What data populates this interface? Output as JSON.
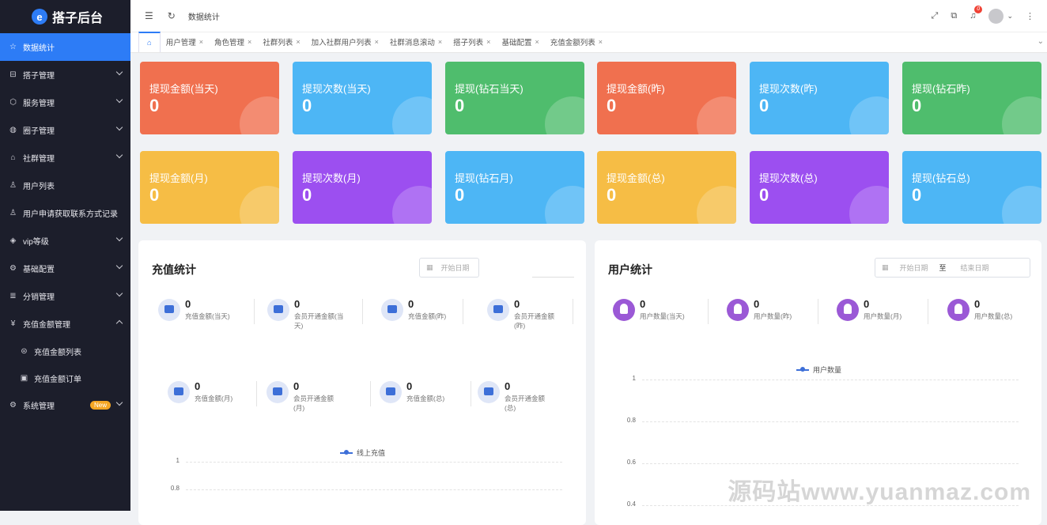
{
  "app": {
    "title": "搭子后台",
    "logo_letter": "e"
  },
  "sidebar": {
    "items": [
      {
        "label": "数据统计",
        "icon": "star-icon"
      },
      {
        "label": "搭子管理",
        "icon": "cart-icon"
      },
      {
        "label": "服务管理",
        "icon": "box-icon"
      },
      {
        "label": "圈子管理",
        "icon": "palette-icon"
      },
      {
        "label": "社群管理",
        "icon": "graduation-icon"
      },
      {
        "label": "用户列表",
        "icon": "users-icon"
      },
      {
        "label": "用户申请获取联系方式记录",
        "icon": "users-icon"
      },
      {
        "label": "vip等级",
        "icon": "layers-icon"
      },
      {
        "label": "基础配置",
        "icon": "gears-icon"
      },
      {
        "label": "分销管理",
        "icon": "list-icon"
      },
      {
        "label": "充值金额管理",
        "icon": "yen-icon"
      },
      {
        "label": "充值金额列表",
        "icon": "yen-circle-icon"
      },
      {
        "label": "充值金额订单",
        "icon": "wallet-icon"
      },
      {
        "label": "系统管理",
        "icon": "settings-icon",
        "badge": "New"
      }
    ]
  },
  "header": {
    "breadcrumb": "数据统计",
    "notifications": "0"
  },
  "tabs": [
    "用户管理",
    "角色管理",
    "社群列表",
    "加入社群用户列表",
    "社群消息滚动",
    "搭子列表",
    "基础配置",
    "充值金额列表"
  ],
  "cards": [
    {
      "label": "提现金额(当天)",
      "value": "0",
      "color": "#f0704f"
    },
    {
      "label": "提现次数(当天)",
      "value": "0",
      "color": "#4db6f5"
    },
    {
      "label": "提现(钻石当天)",
      "value": "0",
      "color": "#4fbd6d"
    },
    {
      "label": "提现金额(昨)",
      "value": "0",
      "color": "#f0704f"
    },
    {
      "label": "提现次数(昨)",
      "value": "0",
      "color": "#4db6f5"
    },
    {
      "label": "提现(钻石昨)",
      "value": "0",
      "color": "#4fbd6d"
    },
    {
      "label": "提现金额(月)",
      "value": "0",
      "color": "#f6bd45"
    },
    {
      "label": "提现次数(月)",
      "value": "0",
      "color": "#9c4ff0"
    },
    {
      "label": "提现(钻石月)",
      "value": "0",
      "color": "#4db6f5"
    },
    {
      "label": "提现金额(总)",
      "value": "0",
      "color": "#f6bd45"
    },
    {
      "label": "提现次数(总)",
      "value": "0",
      "color": "#9c4ff0"
    },
    {
      "label": "提现(钻石总)",
      "value": "0",
      "color": "#4db6f5"
    }
  ],
  "recharge": {
    "title": "充值统计",
    "date_placeholder": "开始日期",
    "stats": [
      {
        "value": "0",
        "label": "充值金额(当天)"
      },
      {
        "value": "0",
        "label": "会员开通金额(当天)"
      },
      {
        "value": "0",
        "label": "充值金额(昨)"
      },
      {
        "value": "0",
        "label": "会员开通金额(昨)"
      },
      {
        "value": "0",
        "label": "充值金额(月)"
      },
      {
        "value": "0",
        "label": "会员开通金额(月)"
      },
      {
        "value": "0",
        "label": "充值金额(总)"
      },
      {
        "value": "0",
        "label": "会员开通金额(总)"
      }
    ],
    "legend": "线上充值",
    "yticks": [
      "1",
      "0.8"
    ]
  },
  "users": {
    "title": "用户统计",
    "start_placeholder": "开始日期",
    "sep": "至",
    "end_placeholder": "结束日期",
    "stats": [
      {
        "value": "0",
        "label": "用户数量(当天)"
      },
      {
        "value": "0",
        "label": "用户数量(昨)"
      },
      {
        "value": "0",
        "label": "用户数量(月)"
      },
      {
        "value": "0",
        "label": "用户数量(总)"
      }
    ],
    "legend": "用户数量",
    "yticks": [
      "1",
      "0.8",
      "0.6",
      "0.4"
    ]
  },
  "watermark": "源码站www.yuanmaz.com"
}
